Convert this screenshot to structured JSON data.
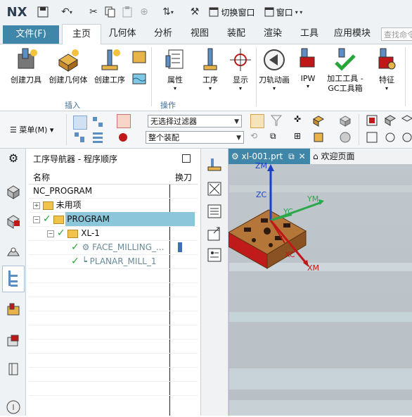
{
  "app": {
    "logo": "NX"
  },
  "quick_access": {
    "switch_window": "切换窗口",
    "window": "窗口"
  },
  "tabs": [
    "文件(F)",
    "主页",
    "几何体",
    "分析",
    "视图",
    "装配",
    "渲染",
    "工具",
    "应用模块"
  ],
  "search": {
    "placeholder": "查找命令"
  },
  "ribbon": {
    "insert_group": {
      "label": "插入",
      "items": [
        "创建刀具",
        "创建几何体",
        "创建工序"
      ]
    },
    "operation_group": {
      "label": "操作",
      "items": [
        "属性",
        "工序",
        "显示"
      ]
    },
    "more": [
      "刀轨动画",
      "IPW",
      "加工工具 - GC工具箱",
      "特征"
    ]
  },
  "toolbar": {
    "menu_label": "菜单(M)",
    "filter": "无选择过滤器",
    "assembly": "整个装配"
  },
  "navigator": {
    "title": "工序导航器 - 程序顺序",
    "col_name": "名称",
    "col_tool": "换刀",
    "rows": [
      "NC_PROGRAM",
      "未用项",
      "PROGRAM",
      "XL-1",
      "FACE_MILLING_...",
      "PLANAR_MILL_1"
    ]
  },
  "graphics": {
    "tabs": [
      {
        "label": "xl-001.prt"
      },
      {
        "label": "欢迎页面"
      }
    ],
    "axes": {
      "zm": "ZM",
      "zc": "ZC",
      "yc": "YC",
      "ym": "YM",
      "xc": "XC",
      "xm": "XM"
    }
  },
  "colors": {
    "accent": "#3f86a8",
    "selected_row": "#8cc6da",
    "green": "#27a53a"
  }
}
